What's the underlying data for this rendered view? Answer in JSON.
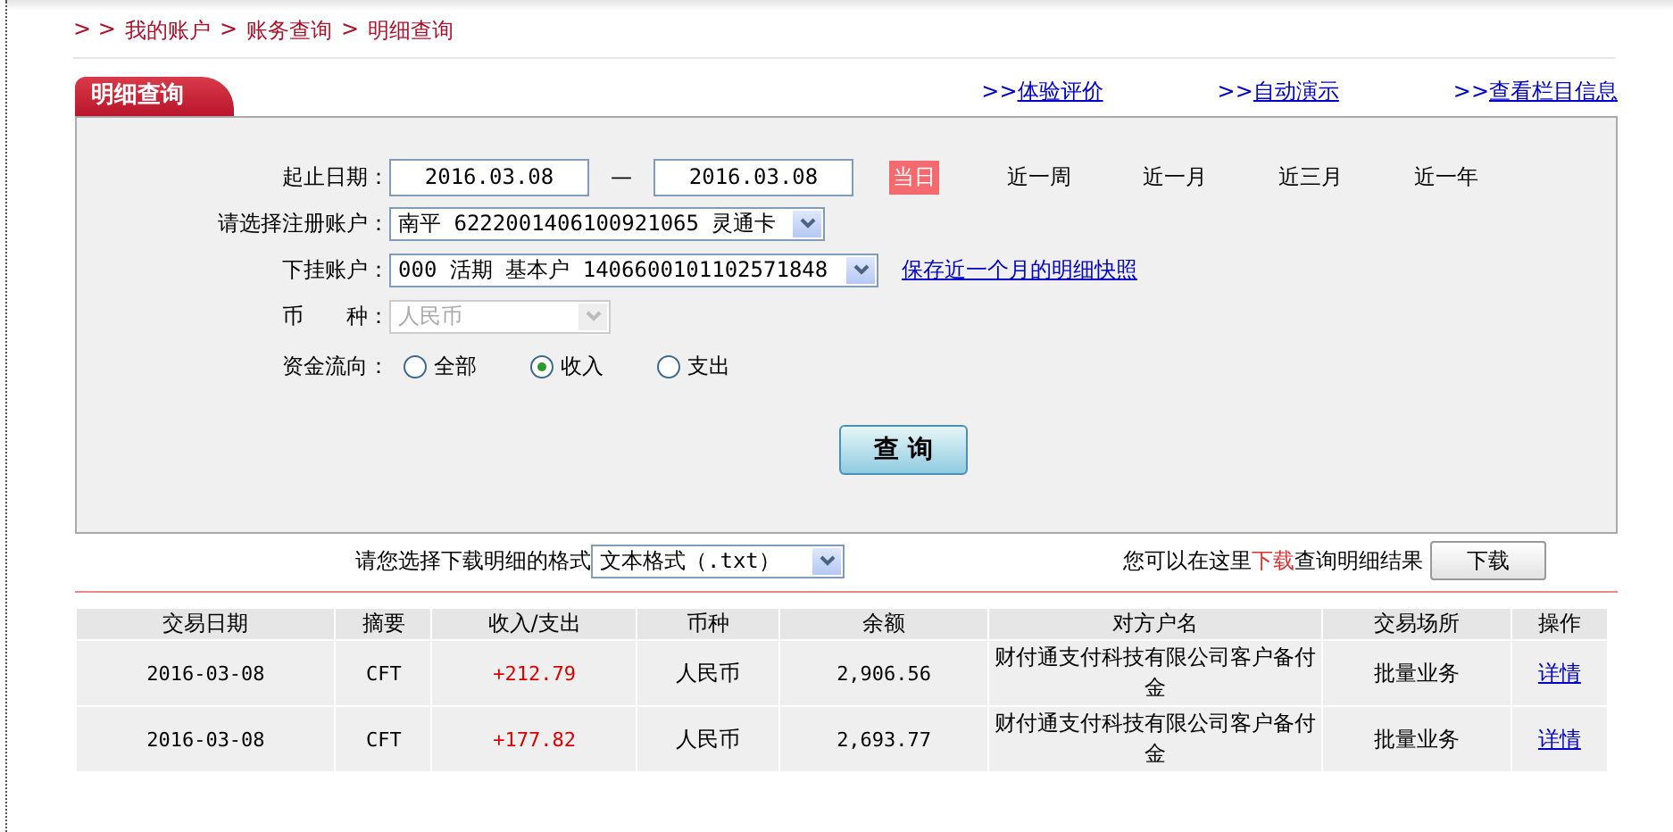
{
  "breadcrumb": {
    "prefix": "> >",
    "separator": ">",
    "items": [
      "我的账户",
      "账务查询",
      "明细查询"
    ]
  },
  "section_tab": {
    "label": "明细查询"
  },
  "header_links": [
    {
      "arrow": ">>",
      "label": "体验评价"
    },
    {
      "arrow": ">>",
      "label": "自动演示"
    },
    {
      "arrow": ">>",
      "label": "查看栏目信息"
    }
  ],
  "date_range": {
    "label": "起止日期：",
    "start": "2016.03.08",
    "separator": "—",
    "end": "2016.03.08",
    "quick_ranges": [
      {
        "label": "当日",
        "selected": true
      },
      {
        "label": "近一周",
        "selected": false
      },
      {
        "label": "近一月",
        "selected": false
      },
      {
        "label": "近三月",
        "selected": false
      },
      {
        "label": "近一年",
        "selected": false
      }
    ]
  },
  "registered_account": {
    "label": "请选择注册账户：",
    "value": "南平 6222001406100921065 灵通卡",
    "disabled": false
  },
  "sub_account": {
    "label": "下挂账户：",
    "value": "000 活期 基本户 1406600101102571848",
    "disabled": false,
    "link": "保存近一个月的明细快照"
  },
  "currency": {
    "label": "币　　种：",
    "value": "人民币",
    "disabled": true
  },
  "fund_flow": {
    "label": "资金流向：",
    "options": [
      {
        "label": "全部",
        "selected": false
      },
      {
        "label": "收入",
        "selected": true
      },
      {
        "label": "支出",
        "selected": false
      }
    ]
  },
  "query_button": "查 询",
  "download": {
    "format_label": "请您选择下载明细的格式",
    "format_value": "文本格式（.txt）",
    "hint": "您可以在这里**下载**查询明细结果",
    "button": "下载"
  },
  "table": {
    "columns": [
      "交易日期",
      "摘要",
      "收入/支出",
      "币种",
      "余额",
      "对方户名",
      "交易场所",
      "操作"
    ],
    "rows": [
      [
        "2016-03-08",
        "CFT",
        "+212.79",
        "人民币",
        "2,906.56",
        "财付通支付科技有限公司客户备付金",
        "批量业务",
        "详情"
      ],
      [
        "2016-03-08",
        "CFT",
        "+177.82",
        "人民币",
        "2,693.77",
        "财付通支付科技有限公司客户备付金",
        "批量业务",
        "详情"
      ]
    ]
  }
}
